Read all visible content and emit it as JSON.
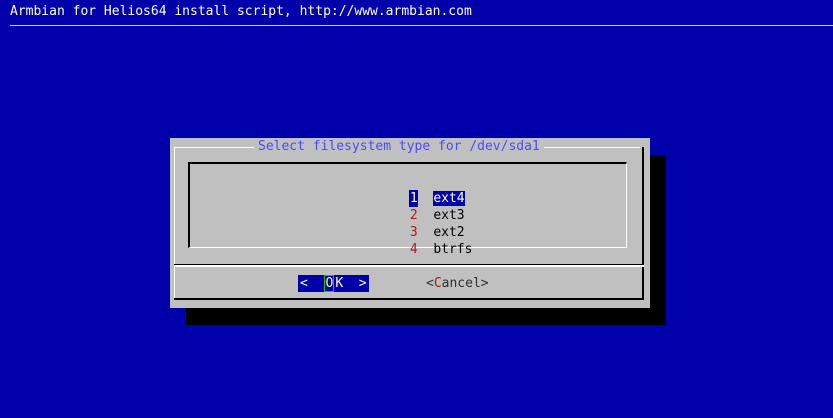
{
  "backtitle": "Armbian for Helios64 install script, http://www.armbian.com",
  "dialog": {
    "title": "Select filesystem type for /dev/sda1",
    "menu": [
      {
        "tag": "1",
        "label": "ext4",
        "selected": true
      },
      {
        "tag": "2",
        "label": "ext3",
        "selected": false
      },
      {
        "tag": "3",
        "label": "ext2",
        "selected": false
      },
      {
        "tag": "4",
        "label": "btrfs",
        "selected": false
      }
    ],
    "buttons": {
      "ok": {
        "left": "<  ",
        "hot": "O",
        "rest": "K",
        "right": "  >"
      },
      "cancel": {
        "left": "<",
        "hot": "C",
        "rest": "ancel",
        "right": ">"
      }
    }
  },
  "colors": {
    "background": "#0000aa",
    "dialog": "#c0c0c0",
    "title": "#4a4aff",
    "tag": "#b21818",
    "selected_bg": "#0000aa",
    "selected_fg": "#ffffff"
  }
}
